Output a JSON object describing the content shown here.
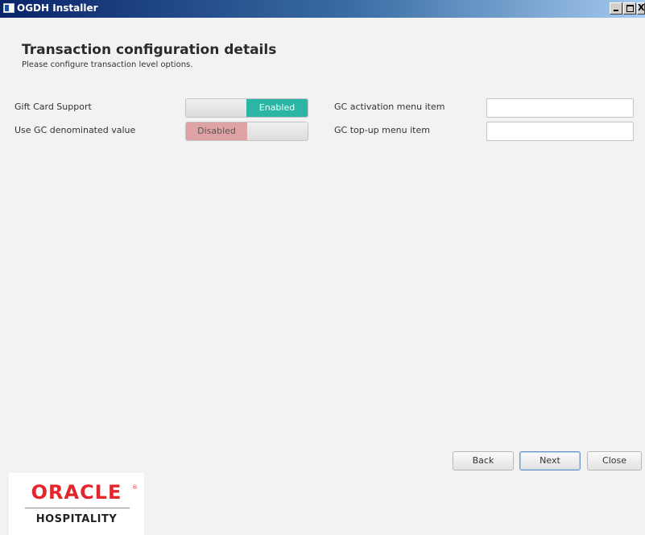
{
  "window": {
    "title": "OGDH Installer",
    "close_glyph": "X"
  },
  "header": {
    "title": "Transaction configuration details",
    "subtitle": "Please configure transaction level options."
  },
  "settings": {
    "gift_card_support": {
      "label": "Gift Card Support",
      "state": "Enabled",
      "color": "#2bb5a5"
    },
    "use_gc_denominated": {
      "label": "Use GC denominated value",
      "state": "Disabled",
      "color": "#dfa3a6"
    },
    "gc_activation_menu_item": {
      "label": "GC activation menu item",
      "value": ""
    },
    "gc_topup_menu_item": {
      "label": "GC top-up menu item",
      "value": ""
    }
  },
  "buttons": {
    "back": "Back",
    "next": "Next",
    "close": "Close"
  },
  "logo": {
    "brand": "ORACLE",
    "registered": "®",
    "division": "HOSPITALITY",
    "color": "#e3262b"
  }
}
